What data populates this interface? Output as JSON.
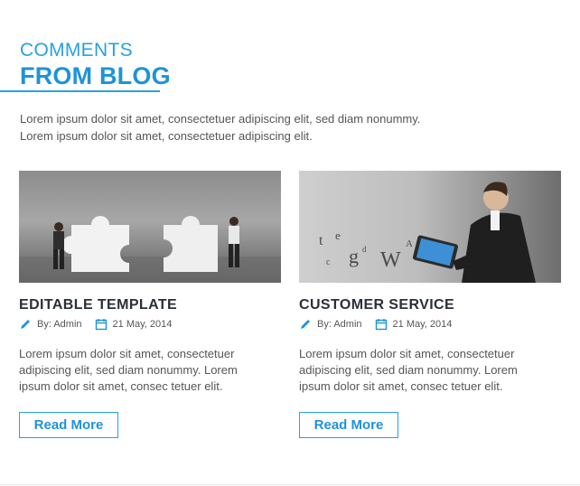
{
  "section": {
    "title_line1": "COMMENTS",
    "title_line2": "FROM BLOG",
    "intro": "Lorem ipsum dolor sit amet, consectetuer adipiscing elit, sed diam nonummy. Lorem ipsum dolor sit amet, consectetuer adipiscing elit."
  },
  "posts": [
    {
      "title": "EDITABLE TEMPLATE",
      "author": "By: Admin",
      "date": "21 May, 2014",
      "excerpt": "Lorem ipsum dolor sit amet, consectetuer adipiscing elit, sed diam nonummy. Lorem ipsum dolor sit amet, consec tetuer elit.",
      "button": "Read More"
    },
    {
      "title": "CUSTOMER SERVICE",
      "author": "By: Admin",
      "date": "21 May, 2014",
      "excerpt": "Lorem ipsum dolor sit amet, consectetuer adipiscing elit, sed diam nonummy. Lorem ipsum dolor sit amet, consec tetuer elit.",
      "button": "Read More"
    }
  ],
  "colors": {
    "accent": "#1e93d9",
    "heading": "#2a2f38",
    "text": "#555555"
  },
  "icons": {
    "author": "pencil-icon",
    "date": "calendar-icon"
  }
}
